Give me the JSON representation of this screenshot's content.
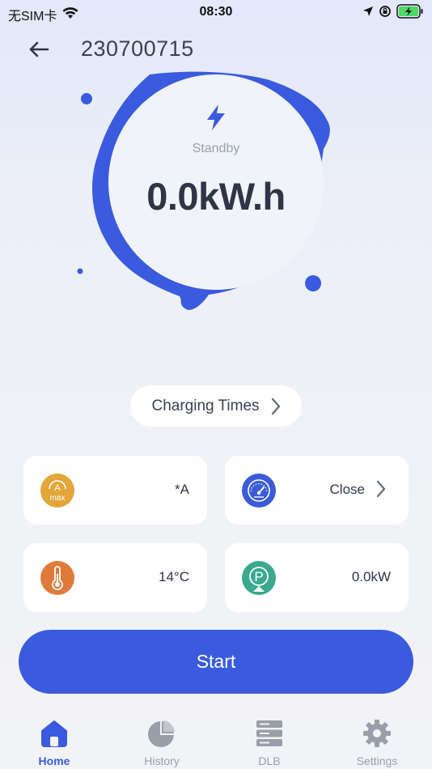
{
  "status_bar": {
    "carrier": "无SIM卡",
    "time": "08:30"
  },
  "header": {
    "title": "230700715"
  },
  "gauge": {
    "status": "Standby",
    "energy": "0.0kW.h",
    "accent": "#3a5bde"
  },
  "charging_times": {
    "label": "Charging Times"
  },
  "cards": {
    "max_current": {
      "value": "*A",
      "icon_text": "A",
      "icon_sub": "max",
      "color": "#e3a63a"
    },
    "meter": {
      "value": "Close",
      "color": "#3b5bd8"
    },
    "temperature": {
      "value": "14°C",
      "color": "#e07a3a"
    },
    "power": {
      "value": "0.0kW",
      "icon_text": "P",
      "color": "#3aa98c"
    }
  },
  "start_button": {
    "label": "Start",
    "color": "#3a5bde"
  },
  "tabs": [
    {
      "label": "Home",
      "icon": "home-icon",
      "active": true
    },
    {
      "label": "History",
      "icon": "pie-chart-icon",
      "active": false
    },
    {
      "label": "DLB",
      "icon": "server-icon",
      "active": false
    },
    {
      "label": "Settings",
      "icon": "gear-icon",
      "active": false
    }
  ]
}
